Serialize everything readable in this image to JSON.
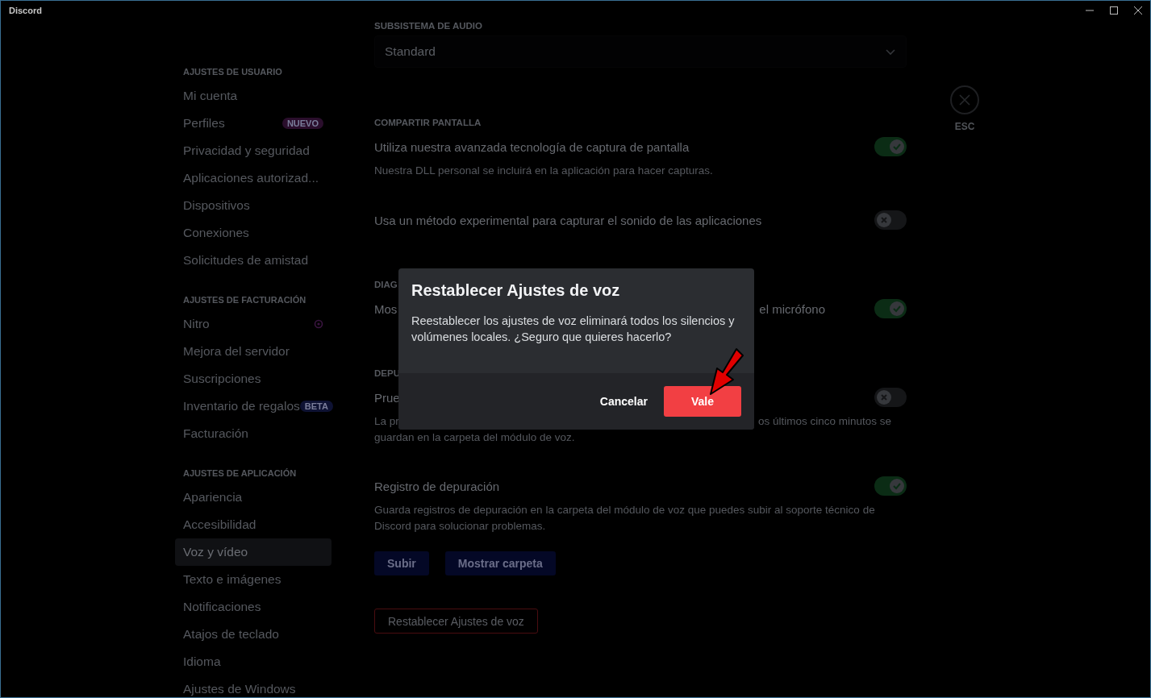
{
  "window": {
    "title": "Discord"
  },
  "sidebar": [
    {
      "heading": "AJUSTES DE USUARIO",
      "items": [
        {
          "kind": "plain",
          "label": "Mi cuenta",
          "selected": false
        },
        {
          "kind": "badge",
          "label": "Perfiles",
          "selected": false,
          "badge": "NUEVO",
          "color": "#2a0e2c"
        },
        {
          "kind": "plain",
          "label": "Privacidad y seguridad",
          "selected": false
        },
        {
          "kind": "plain",
          "label": "Aplicaciones autorizad...",
          "selected": false
        },
        {
          "kind": "plain",
          "label": "Dispositivos",
          "selected": false
        },
        {
          "kind": "plain",
          "label": "Conexiones",
          "selected": false
        },
        {
          "kind": "plain",
          "label": "Solicitudes de amistad",
          "selected": false
        }
      ]
    },
    {
      "heading": "AJUSTES DE FACTURACIÓN",
      "items": [
        {
          "kind": "nitro",
          "label": "Nitro",
          "selected": false
        },
        {
          "kind": "plain",
          "label": "Mejora del servidor",
          "selected": false
        },
        {
          "kind": "plain",
          "label": "Suscripciones",
          "selected": false
        },
        {
          "kind": "badge",
          "label": "Inventario de regalos",
          "selected": false,
          "badge": "BETA",
          "color": "#0e1233"
        },
        {
          "kind": "plain",
          "label": "Facturación",
          "selected": false
        }
      ]
    },
    {
      "heading": "AJUSTES DE APLICACIÓN",
      "items": [
        {
          "kind": "plain",
          "label": "Apariencia",
          "selected": false
        },
        {
          "kind": "plain",
          "label": "Accesibilidad",
          "selected": false
        },
        {
          "kind": "plain",
          "label": "Voz y vídeo",
          "selected": true
        },
        {
          "kind": "plain",
          "label": "Texto e imágenes",
          "selected": false
        },
        {
          "kind": "plain",
          "label": "Notificaciones",
          "selected": false
        },
        {
          "kind": "plain",
          "label": "Atajos de teclado",
          "selected": false
        },
        {
          "kind": "plain",
          "label": "Idioma",
          "selected": false
        },
        {
          "kind": "plain",
          "label": "Ajustes de Windows",
          "selected": false
        }
      ]
    }
  ],
  "audio_subsystem": {
    "heading": "SUBSISTEMA DE AUDIO",
    "value": "Standard"
  },
  "sections": [
    {
      "heading": "COMPARTIR PANTALLA",
      "rows": [
        {
          "kind": "toggle",
          "title": "Utiliza nuestra avanzada tecnología de captura de pantalla",
          "on": true,
          "description": [
            "Nuestra DLL personal se incluirá en la aplicación para hacer capturas."
          ]
        },
        {
          "kind": "toggle",
          "title": "Usa un método experimental para capturar el sonido de las aplicaciones",
          "on": false
        }
      ]
    },
    {
      "heading": "DIAG",
      "rows": [
        {
          "kind": "partial",
          "title": "Mos",
          "title_after": "el micrófono",
          "on": true
        }
      ]
    },
    {
      "heading": "DEPU",
      "rows": [
        {
          "kind": "partial",
          "title": "Prue",
          "on": false,
          "description_partial": {
            "before": "La pr",
            "after": "os últimos cinco minutos se"
          },
          "description": [
            "guardan en la carpeta del módulo de voz."
          ]
        }
      ]
    },
    {
      "rows": [
        {
          "kind": "toggle",
          "title": "Registro de depuración",
          "on": true,
          "description": [
            "Guarda registros de depuración en la carpeta del módulo de voz que puedes subir al soporte técnico de Discord para solucionar problemas."
          ],
          "buttons": [
            "Subir",
            "Mostrar carpeta"
          ]
        }
      ]
    }
  ],
  "reset_button": "Restablecer Ajustes de voz",
  "close": {
    "label": "ESC"
  },
  "dialog": {
    "title": "Restablecer Ajustes de voz",
    "body": "Reestablecer los ajustes de voz eliminará todos los silencios y volúmenes locales. ¿Seguro que quieres hacerlo?",
    "cancel": "Cancelar",
    "confirm": "Vale"
  }
}
